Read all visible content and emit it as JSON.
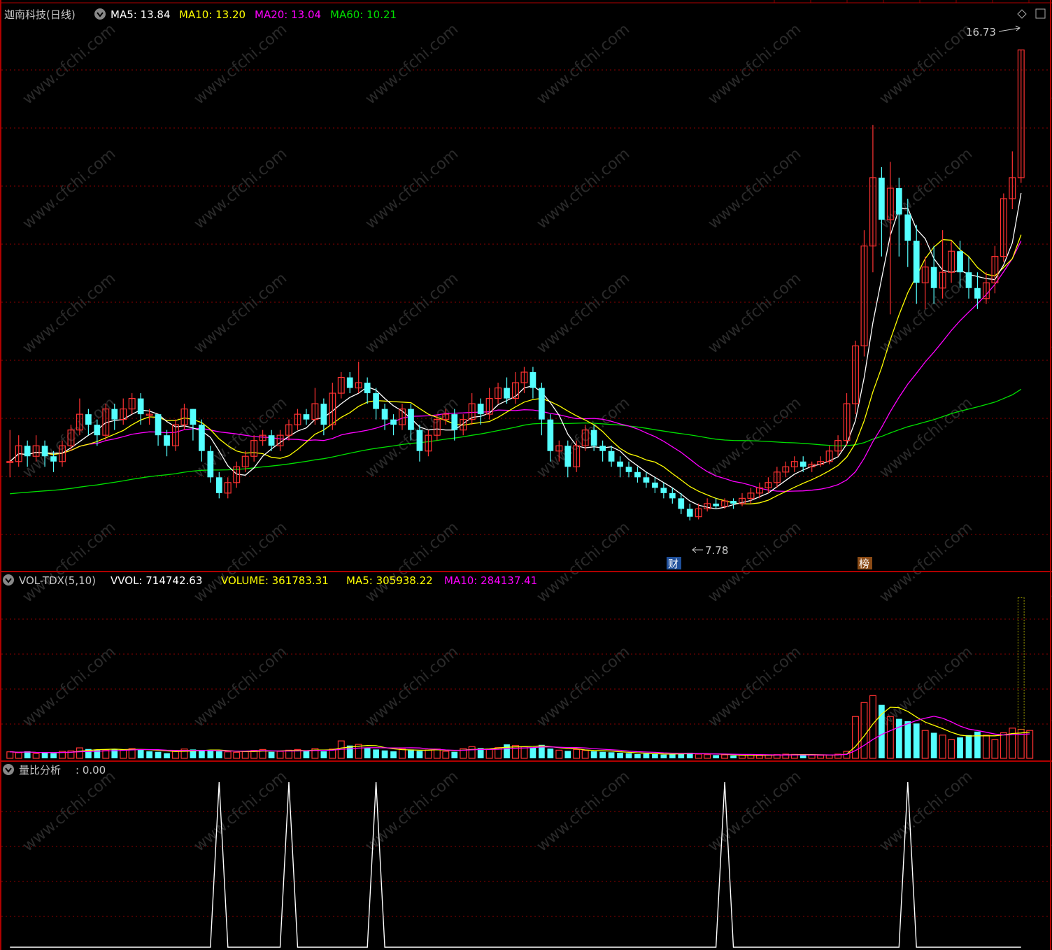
{
  "header": {
    "stock_title": "迦南科技(日线)",
    "ma_labels": [
      {
        "text": "MA5: 13.84",
        "color": "#ffffff"
      },
      {
        "text": "MA10: 13.20",
        "color": "#ffff00"
      },
      {
        "text": "MA20: 13.04",
        "color": "#ff00ff"
      },
      {
        "text": "MA60: 10.21",
        "color": "#00e000"
      }
    ]
  },
  "price_panel": {
    "high_marker": "16.73",
    "low_marker": "7.78",
    "event_tags": [
      "财",
      "榜"
    ]
  },
  "volume_panel": {
    "title": "VOL-TDX(5,10)",
    "labels": [
      {
        "text": "VVOL: 714742.63",
        "color": "#ffffff"
      },
      {
        "text": "VOLUME: 361783.31",
        "color": "#ffff00"
      },
      {
        "text": "MA5: 305938.22",
        "color": "#ffff00"
      },
      {
        "text": "MA10: 284137.41",
        "color": "#ff00ff"
      }
    ]
  },
  "ratio_panel": {
    "title": "量比分析",
    "value": ": 0.00"
  },
  "watermark": "www.cfchi.com",
  "colors": {
    "up": "#ff3232",
    "down": "#54ffff",
    "grid": "#8b0000",
    "ma5": "#ffffff",
    "ma10": "#ffff00",
    "ma20": "#ff00ff",
    "ma60": "#00e000"
  },
  "chart_data": {
    "type": "candlestick",
    "ylim": [
      7.3,
      17.2
    ],
    "vol_max": 720000,
    "ratio_max": 1.0,
    "high": 16.73,
    "low": 7.78,
    "candles": [
      [
        8.9,
        8.9,
        9.5,
        8.6
      ],
      [
        8.9,
        9.2,
        9.4,
        8.8
      ],
      [
        9.2,
        9.0,
        9.3,
        8.8
      ],
      [
        9.0,
        9.2,
        9.4,
        8.9
      ],
      [
        9.2,
        9.0,
        9.3,
        8.8
      ],
      [
        9.0,
        8.9,
        9.1,
        8.7
      ],
      [
        8.9,
        9.2,
        9.3,
        8.8
      ],
      [
        9.2,
        9.5,
        9.6,
        9.1
      ],
      [
        9.5,
        9.8,
        10.1,
        9.4
      ],
      [
        9.8,
        9.6,
        9.9,
        9.4
      ],
      [
        9.6,
        9.4,
        9.7,
        9.2
      ],
      [
        9.4,
        9.9,
        10.0,
        9.3
      ],
      [
        9.9,
        9.7,
        10.0,
        9.5
      ],
      [
        9.7,
        9.9,
        10.1,
        9.6
      ],
      [
        9.9,
        10.1,
        10.2,
        9.8
      ],
      [
        10.1,
        9.8,
        10.2,
        9.6
      ],
      [
        9.8,
        9.8,
        9.9,
        9.6
      ],
      [
        9.8,
        9.4,
        9.8,
        9.2
      ],
      [
        9.4,
        9.2,
        9.5,
        9.0
      ],
      [
        9.2,
        9.6,
        9.7,
        9.1
      ],
      [
        9.6,
        9.9,
        10.0,
        9.5
      ],
      [
        9.9,
        9.6,
        9.9,
        9.3
      ],
      [
        9.6,
        9.1,
        9.7,
        8.9
      ],
      [
        9.1,
        8.6,
        9.2,
        8.5
      ],
      [
        8.6,
        8.3,
        8.7,
        8.2
      ],
      [
        8.3,
        8.5,
        8.6,
        8.2
      ],
      [
        8.5,
        8.8,
        8.9,
        8.4
      ],
      [
        8.8,
        9.0,
        9.1,
        8.7
      ],
      [
        9.0,
        9.3,
        9.4,
        8.9
      ],
      [
        9.3,
        9.4,
        9.5,
        9.2
      ],
      [
        9.4,
        9.2,
        9.5,
        9.1
      ],
      [
        9.2,
        9.4,
        9.5,
        9.1
      ],
      [
        9.4,
        9.6,
        9.7,
        9.3
      ],
      [
        9.6,
        9.8,
        9.9,
        9.5
      ],
      [
        9.8,
        9.7,
        9.9,
        9.6
      ],
      [
        9.7,
        10.0,
        10.3,
        9.6
      ],
      [
        10.0,
        9.6,
        10.1,
        9.4
      ],
      [
        9.6,
        10.2,
        10.4,
        9.5
      ],
      [
        10.2,
        10.5,
        10.6,
        10.1
      ],
      [
        10.5,
        10.3,
        10.6,
        10.2
      ],
      [
        10.3,
        10.4,
        10.8,
        10.2
      ],
      [
        10.4,
        10.2,
        10.5,
        10.0
      ],
      [
        10.2,
        9.9,
        10.3,
        9.7
      ],
      [
        9.9,
        9.7,
        10.0,
        9.5
      ],
      [
        9.7,
        9.6,
        9.8,
        9.4
      ],
      [
        9.6,
        9.9,
        10.0,
        9.5
      ],
      [
        9.9,
        9.5,
        10.0,
        9.3
      ],
      [
        9.5,
        9.1,
        9.6,
        8.9
      ],
      [
        9.1,
        9.4,
        9.5,
        9.0
      ],
      [
        9.4,
        9.7,
        9.8,
        9.3
      ],
      [
        9.7,
        9.8,
        9.9,
        9.6
      ],
      [
        9.8,
        9.5,
        9.9,
        9.3
      ],
      [
        9.5,
        9.7,
        9.8,
        9.4
      ],
      [
        9.7,
        10.0,
        10.2,
        9.6
      ],
      [
        10.0,
        9.8,
        10.1,
        9.6
      ],
      [
        9.8,
        10.1,
        10.3,
        9.7
      ],
      [
        10.1,
        10.3,
        10.4,
        10.0
      ],
      [
        10.3,
        10.1,
        10.5,
        10.0
      ],
      [
        10.1,
        10.4,
        10.6,
        10.0
      ],
      [
        10.4,
        10.6,
        10.7,
        10.2
      ],
      [
        10.6,
        10.3,
        10.7,
        10.1
      ],
      [
        10.3,
        9.7,
        10.4,
        9.4
      ],
      [
        9.7,
        9.1,
        9.8,
        8.9
      ],
      [
        9.1,
        9.2,
        9.3,
        8.9
      ],
      [
        9.2,
        8.8,
        9.3,
        8.6
      ],
      [
        8.8,
        9.2,
        9.3,
        8.7
      ],
      [
        9.2,
        9.5,
        9.6,
        9.1
      ],
      [
        9.5,
        9.2,
        9.6,
        9.1
      ],
      [
        9.2,
        9.1,
        9.3,
        8.9
      ],
      [
        9.1,
        8.9,
        9.2,
        8.8
      ],
      [
        8.9,
        8.8,
        9.0,
        8.6
      ],
      [
        8.8,
        8.7,
        8.9,
        8.6
      ],
      [
        8.7,
        8.6,
        8.8,
        8.5
      ],
      [
        8.6,
        8.5,
        8.7,
        8.4
      ],
      [
        8.5,
        8.4,
        8.6,
        8.3
      ],
      [
        8.4,
        8.3,
        8.5,
        8.2
      ],
      [
        8.3,
        8.2,
        8.4,
        8.1
      ],
      [
        8.2,
        8.0,
        8.3,
        7.9
      ],
      [
        8.0,
        7.85,
        8.1,
        7.78
      ],
      [
        7.85,
        8.0,
        8.1,
        7.8
      ],
      [
        8.0,
        8.1,
        8.2,
        7.95
      ],
      [
        8.1,
        8.05,
        8.2,
        8.0
      ],
      [
        8.05,
        8.15,
        8.2,
        8.0
      ],
      [
        8.15,
        8.1,
        8.2,
        8.0
      ],
      [
        8.1,
        8.2,
        8.3,
        8.05
      ],
      [
        8.2,
        8.3,
        8.4,
        8.1
      ],
      [
        8.3,
        8.4,
        8.5,
        8.2
      ],
      [
        8.4,
        8.5,
        8.6,
        8.3
      ],
      [
        8.5,
        8.7,
        8.8,
        8.4
      ],
      [
        8.7,
        8.8,
        8.9,
        8.6
      ],
      [
        8.8,
        8.9,
        9.0,
        8.7
      ],
      [
        8.9,
        8.8,
        9.0,
        8.7
      ],
      [
        8.8,
        8.85,
        8.9,
        8.7
      ],
      [
        8.85,
        8.9,
        9.0,
        8.8
      ],
      [
        8.9,
        9.1,
        9.2,
        8.85
      ],
      [
        9.1,
        9.3,
        9.4,
        9.0
      ],
      [
        9.3,
        10.0,
        10.2,
        9.2
      ],
      [
        10.0,
        11.1,
        11.2,
        9.8
      ],
      [
        11.1,
        13.0,
        13.3,
        10.9
      ],
      [
        13.0,
        14.3,
        15.3,
        12.5
      ],
      [
        14.3,
        13.5,
        14.5,
        12.8
      ],
      [
        13.5,
        14.1,
        14.6,
        11.7
      ],
      [
        14.1,
        13.6,
        14.3,
        12.8
      ],
      [
        13.6,
        13.1,
        13.9,
        12.6
      ],
      [
        13.1,
        12.3,
        13.4,
        11.9
      ],
      [
        12.3,
        12.6,
        12.8,
        11.8
      ],
      [
        12.6,
        12.2,
        13.0,
        11.9
      ],
      [
        12.2,
        12.5,
        13.3,
        12.0
      ],
      [
        12.5,
        12.9,
        13.1,
        12.3
      ],
      [
        12.9,
        12.5,
        13.1,
        12.2
      ],
      [
        12.5,
        12.2,
        12.8,
        12.0
      ],
      [
        12.2,
        12.0,
        12.5,
        11.8
      ],
      [
        12.0,
        12.3,
        12.5,
        11.9
      ],
      [
        12.3,
        12.8,
        13.0,
        12.1
      ],
      [
        12.8,
        13.9,
        14.0,
        12.7
      ],
      [
        13.9,
        14.3,
        14.8,
        13.7
      ],
      [
        14.3,
        16.73,
        16.73,
        14.2
      ]
    ],
    "volumes": [
      28000,
      24000,
      30000,
      20000,
      25000,
      22000,
      30000,
      32000,
      45000,
      40000,
      38000,
      36000,
      40000,
      35000,
      42000,
      38000,
      30000,
      28000,
      22000,
      30000,
      40000,
      38000,
      36000,
      34000,
      30000,
      28000,
      26000,
      30000,
      34000,
      38000,
      28000,
      30000,
      35000,
      38000,
      34000,
      42000,
      30000,
      40000,
      75000,
      55000,
      60000,
      45000,
      38000,
      34000,
      30000,
      40000,
      38000,
      32000,
      36000,
      40000,
      30000,
      28000,
      42000,
      50000,
      44000,
      40000,
      46000,
      60000,
      55000,
      50000,
      46000,
      58000,
      42000,
      35000,
      32000,
      38000,
      34000,
      30000,
      28000,
      26000,
      24000,
      22000,
      18000,
      20000,
      18000,
      16000,
      20000,
      22000,
      24000,
      18000,
      16000,
      14000,
      15000,
      12000,
      13000,
      14000,
      12000,
      15000,
      16000,
      18000,
      17000,
      15000,
      14000,
      13000,
      14000,
      18000,
      30000,
      180000,
      240000,
      270000,
      230000,
      180000,
      170000,
      160000,
      150000,
      120000,
      110000,
      100000,
      80000,
      90000,
      100000,
      115000,
      100000,
      80000,
      110000,
      130000,
      125000,
      120000
    ],
    "vol_up": [
      true,
      true,
      false,
      true,
      false,
      false,
      true,
      true,
      true,
      false,
      false,
      true,
      false,
      true,
      true,
      false,
      false,
      false,
      false,
      true,
      true,
      false,
      false,
      false,
      false,
      true,
      true,
      true,
      true,
      true,
      false,
      true,
      true,
      true,
      false,
      true,
      false,
      true,
      true,
      false,
      true,
      false,
      false,
      false,
      false,
      true,
      false,
      false,
      true,
      true,
      true,
      false,
      true,
      true,
      false,
      true,
      true,
      false,
      true,
      true,
      false,
      false,
      false,
      true,
      false,
      true,
      true,
      false,
      false,
      false,
      false,
      false,
      false,
      false,
      false,
      false,
      false,
      false,
      false,
      true,
      true,
      false,
      true,
      false,
      true,
      true,
      true,
      true,
      true,
      true,
      true,
      false,
      true,
      true,
      true,
      true,
      true,
      true,
      true,
      true,
      false,
      true,
      false,
      false,
      false,
      true,
      false,
      true,
      true,
      false,
      false,
      false,
      true,
      true,
      true,
      true,
      true,
      true
    ],
    "vol_max_unit": 720000,
    "ratio_spikes": [
      24,
      32,
      42,
      82,
      103
    ]
  }
}
